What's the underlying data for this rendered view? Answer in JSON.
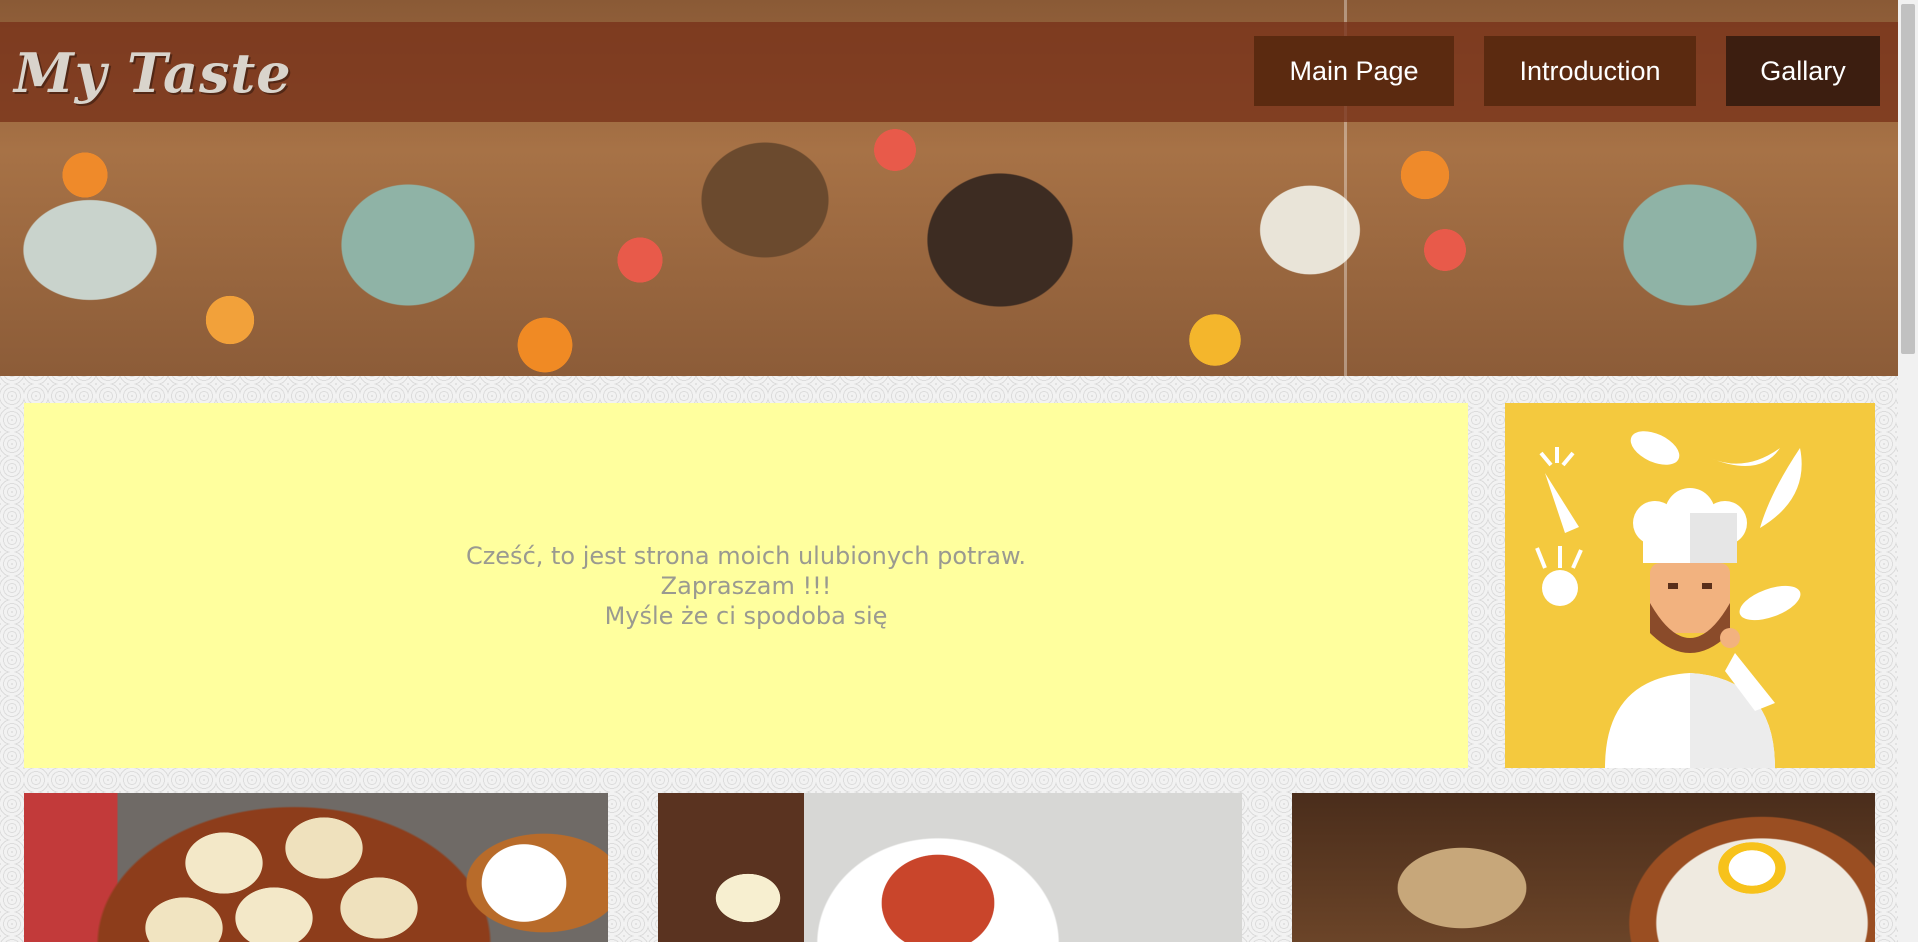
{
  "header": {
    "logo_text": "My Taste",
    "nav": [
      {
        "label": "Main Page"
      },
      {
        "label": "Introduction"
      },
      {
        "label": "Gallary"
      }
    ]
  },
  "welcome": {
    "lines": [
      "Cześć, to jest strona moich ulubionych potraw.",
      "Zapraszam !!!",
      "Myśle że ci spodoba się"
    ]
  },
  "colors": {
    "navbar": "#7a3219",
    "nav_button": "#5b2a10",
    "nav_button_active": "#3c1e10",
    "welcome_panel": "#ffff9e",
    "chef_panel": "#f4c93e",
    "welcome_text": "#9a9a90"
  },
  "images": {
    "hero": "festive-dinner-table-image",
    "chef": "chef-with-vegetables-illustration",
    "dishes": [
      "pierogi-image",
      "stewed-cabbage-image",
      "zurek-soup-image"
    ]
  }
}
